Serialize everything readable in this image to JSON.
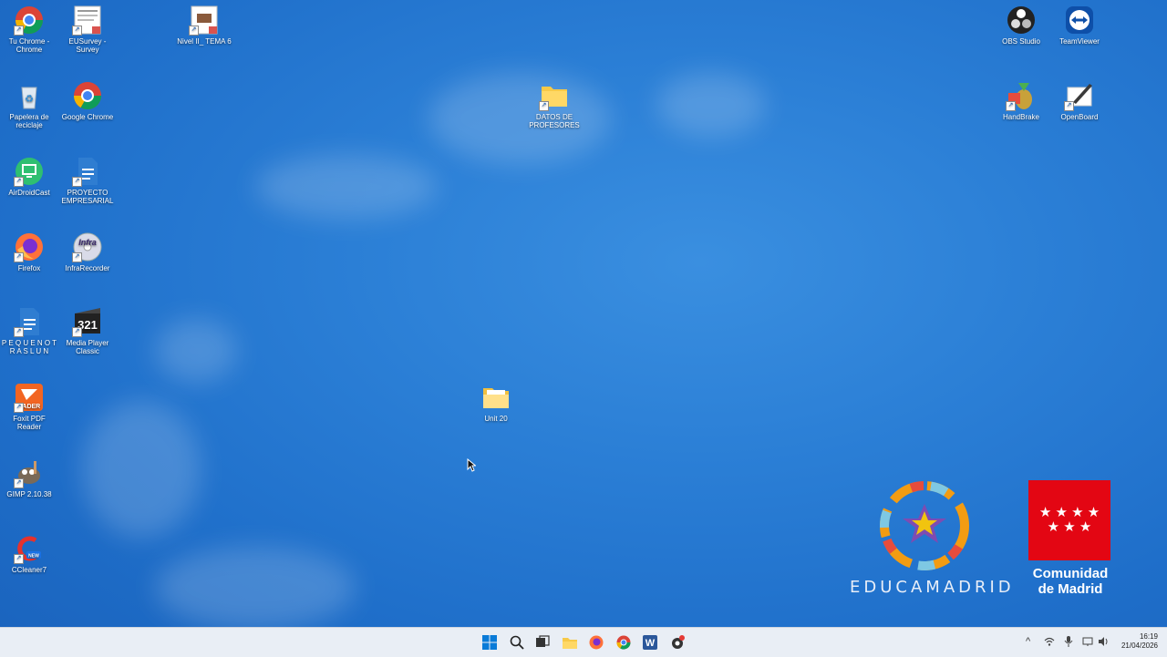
{
  "desktop": {
    "icons": [
      {
        "label": "Tu Chrome - Chrome",
        "icon": "chrome-icon"
      },
      {
        "label": "EUSurvey - Survey",
        "icon": "document-icon"
      },
      {
        "label": "Nivel II_ TEMA 6",
        "icon": "document-icon"
      },
      {
        "label": "OBS Studio",
        "icon": "obs-icon"
      },
      {
        "label": "TeamViewer",
        "icon": "teamviewer-icon"
      },
      {
        "label": "Papelera de reciclaje",
        "icon": "recycle-bin-icon"
      },
      {
        "label": "Google Chrome",
        "icon": "chrome-icon"
      },
      {
        "label": "DATOS DE PROFESORES",
        "icon": "folder-icon"
      },
      {
        "label": "HandBrake",
        "icon": "handbrake-icon"
      },
      {
        "label": "OpenBoard",
        "icon": "openboard-icon"
      },
      {
        "label": "AirDroidCast",
        "icon": "airdroid-icon"
      },
      {
        "label": "PROYECTO EMPRESARIAL",
        "icon": "document-icon"
      },
      {
        "label": "Firefox",
        "icon": "firefox-icon"
      },
      {
        "label": "InfraRecorder",
        "icon": "infrarecorder-icon"
      },
      {
        "label": "P E Q U E N O T R A S L U N",
        "icon": "document-icon"
      },
      {
        "label": "Media Player Classic",
        "icon": "mpc-icon"
      },
      {
        "label": "Foxit PDF Reader",
        "icon": "foxit-icon"
      },
      {
        "label": "Unit 20",
        "icon": "folder-icon"
      },
      {
        "label": "GIMP 2.10.38",
        "icon": "gimp-icon"
      },
      {
        "label": "CCleaner7",
        "icon": "ccleaner-icon"
      }
    ]
  },
  "branding": {
    "educamadrid": "EDUCAMADRID",
    "comunidad_line1": "Comunidad",
    "comunidad_line2": "de Madrid",
    "flag_stars": "★ ★ ★ ★\n★ ★ ★",
    "colors": {
      "madrid_red": "#e30613"
    }
  },
  "taskbar": {
    "apps": [
      "windows-start-icon",
      "search-icon",
      "task-view-icon",
      "file-explorer-icon",
      "firefox-icon",
      "chrome-icon",
      "word-icon",
      "record-icon"
    ],
    "clock_time": "16:19",
    "clock_date": "21/04/2026"
  }
}
